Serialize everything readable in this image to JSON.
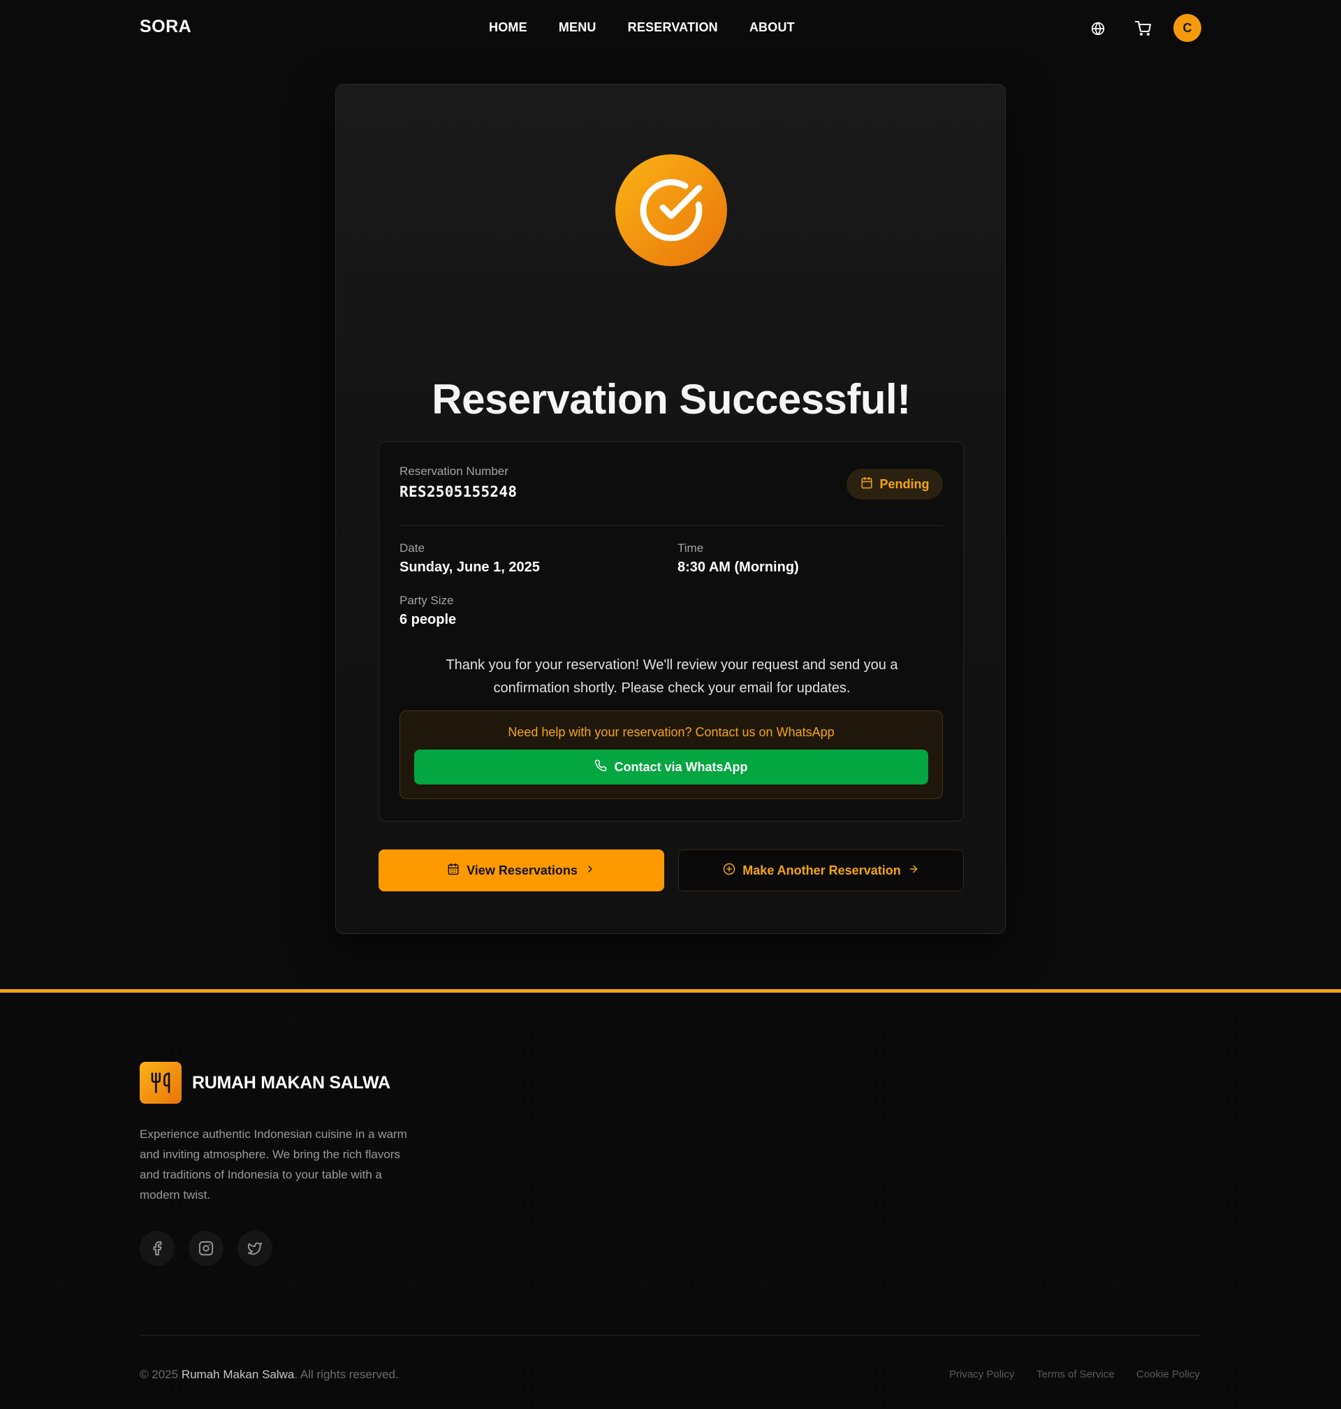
{
  "header": {
    "logo": "SORA",
    "nav": [
      "HOME",
      "MENU",
      "RESERVATION",
      "ABOUT"
    ],
    "icons": [
      "globe-icon",
      "cart-icon"
    ],
    "avatar_initial": "C"
  },
  "confirmation": {
    "title": "Reservation Successful!",
    "reservation_number_label": "Reservation Number",
    "reservation_number": "RES2505155248",
    "status": "Pending",
    "date_label": "Date",
    "date": "Sunday, June 1, 2025",
    "time_label": "Time",
    "time": "8:30 AM (Morning)",
    "party_label": "Party Size",
    "party": "6 people",
    "message": "Thank you for your reservation! We'll review your request and send you a confirmation shortly. Please check your email for updates.",
    "help_text": "Need help with your reservation? Contact us on WhatsApp",
    "whatsapp_button": "Contact via WhatsApp",
    "view_button": "View Reservations",
    "another_button": "Make Another Reservation"
  },
  "footer": {
    "name": "RUMAH MAKAN SALWA",
    "description": "Experience authentic Indonesian cuisine in a warm and inviting atmosphere. We bring the rich flavors and traditions of Indonesia to your table with a modern twist.",
    "social": [
      "facebook-icon",
      "instagram-icon",
      "twitter-icon"
    ],
    "copyright_prefix": "© 2025",
    "copyright_brand": "Rumah Makan Salwa",
    "copyright_suffix": ". All rights reserved.",
    "links": [
      "Privacy Policy",
      "Terms of Service",
      "Cookie Policy"
    ]
  },
  "colors": {
    "accent": "#fe9a00",
    "whatsapp": "#03a640",
    "background": "#0b0b0b"
  }
}
